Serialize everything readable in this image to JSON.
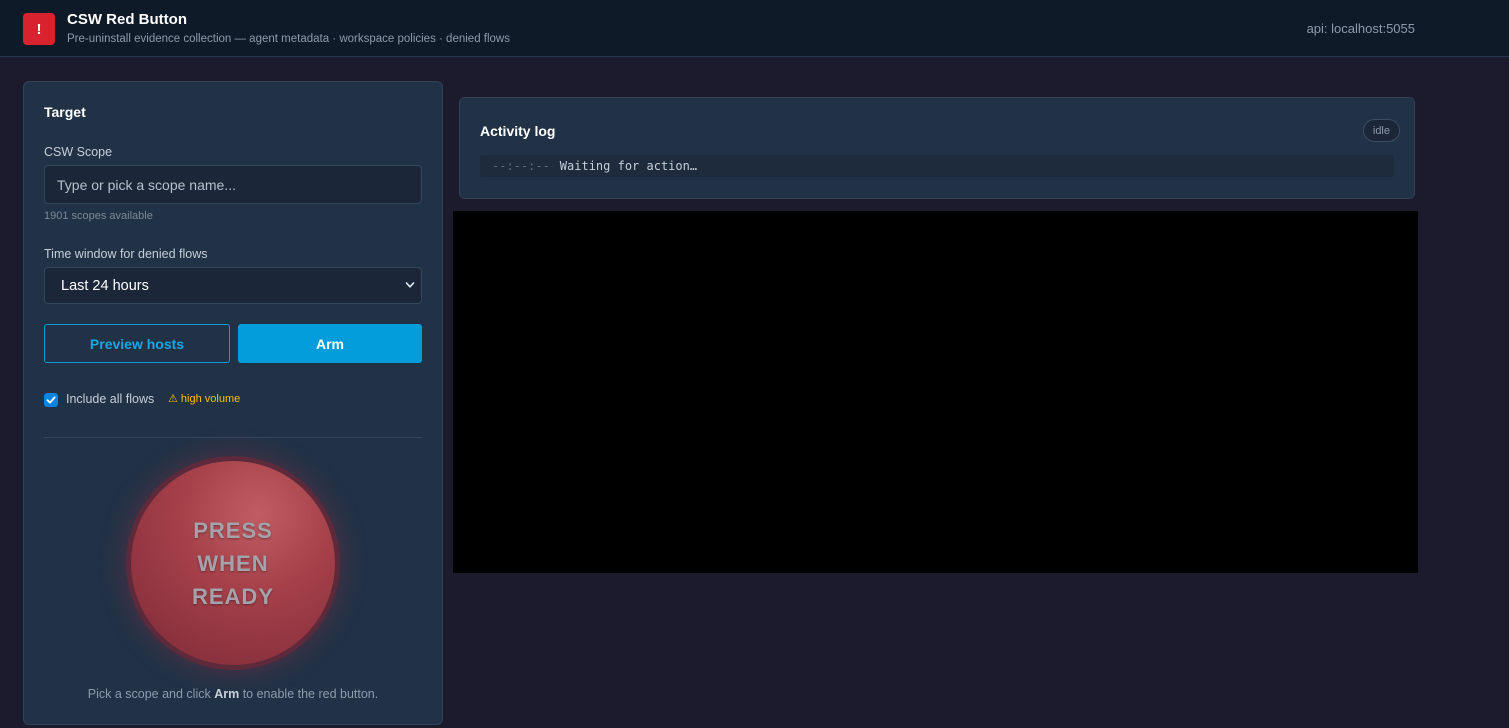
{
  "header": {
    "logo_glyph": "!",
    "title": "CSW Red Button",
    "subtitle": "Pre-uninstall evidence collection — agent metadata · workspace policies · denied flows",
    "api": "api: localhost:5055"
  },
  "target": {
    "heading": "Target",
    "scope_label": "CSW Scope",
    "scope_placeholder": "Type or pick a scope name...",
    "scope_value": "",
    "scopes_available": "1901 scopes available",
    "time_label": "Time window for denied flows",
    "time_selected": "Last 24 hours",
    "preview_label": "Preview hosts",
    "arm_label": "Arm",
    "include_all_checked": true,
    "include_all_label": "Include all flows",
    "high_volume_label": "⚠ high volume",
    "red_button_text": "PRESS\nWHEN\nREADY",
    "hint_prefix": "Pick a scope and click ",
    "hint_bold": "Arm",
    "hint_suffix": " to enable the red button."
  },
  "activity": {
    "title": "Activity log",
    "status": "idle",
    "entries": [
      {
        "time": "--:--:--",
        "message": "Waiting for action…"
      }
    ]
  },
  "colors": {
    "accent": "#049ddc",
    "danger": "#d8232f",
    "warning": "#f2c200"
  },
  "icons": {
    "logo": "alert-icon",
    "select": "chevron-down-icon",
    "checkbox": "check-icon"
  }
}
